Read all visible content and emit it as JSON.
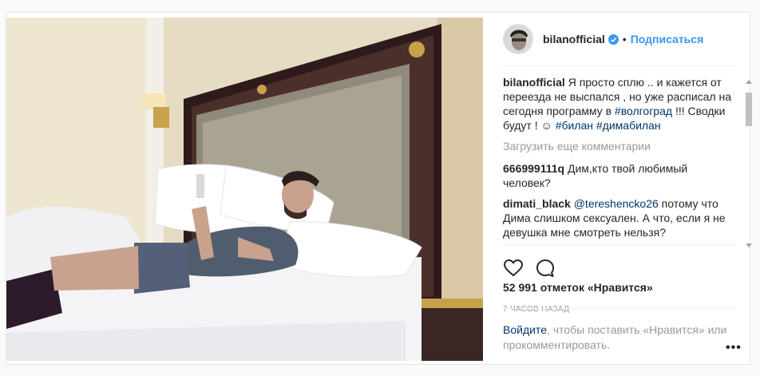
{
  "header": {
    "username": "bilanofficial",
    "separator": "•",
    "follow_label": "Подписаться"
  },
  "caption": {
    "username": "bilanofficial",
    "text_1": "Я просто сплю .. и кажется от переезда не выспался , но уже расписал на сегодня программу в",
    "tag_1": "#волгоград",
    "text_2": "!!! Сводки будут ! ☺",
    "tag_2": "#билан",
    "tag_3": "#димабилан"
  },
  "load_more": "Загрузить еще комментарии",
  "comments": [
    {
      "username": "666999111q",
      "mention": "",
      "text": "Дим,кто твой любимый человек?"
    },
    {
      "username": "dimati_black",
      "mention": "@tereshencko26",
      "text": "потому что Дима слишком сексуален. А что, если я не девушка мне смотреть нельзя?"
    }
  ],
  "likes": "52 991 отметок «Нравится»",
  "time": "7 ЧАСОВ НАЗАД",
  "login": {
    "link": "Войдите",
    "text": ", чтобы поставить «Нравится» или прокомментировать."
  },
  "more_label": "•••",
  "icons": {
    "verified": "verified-badge-icon",
    "like": "heart-icon",
    "comment": "comment-bubble-icon",
    "more": "more-options-icon"
  },
  "colors": {
    "accent": "#3897f0",
    "link": "#003569",
    "muted": "#999999"
  }
}
